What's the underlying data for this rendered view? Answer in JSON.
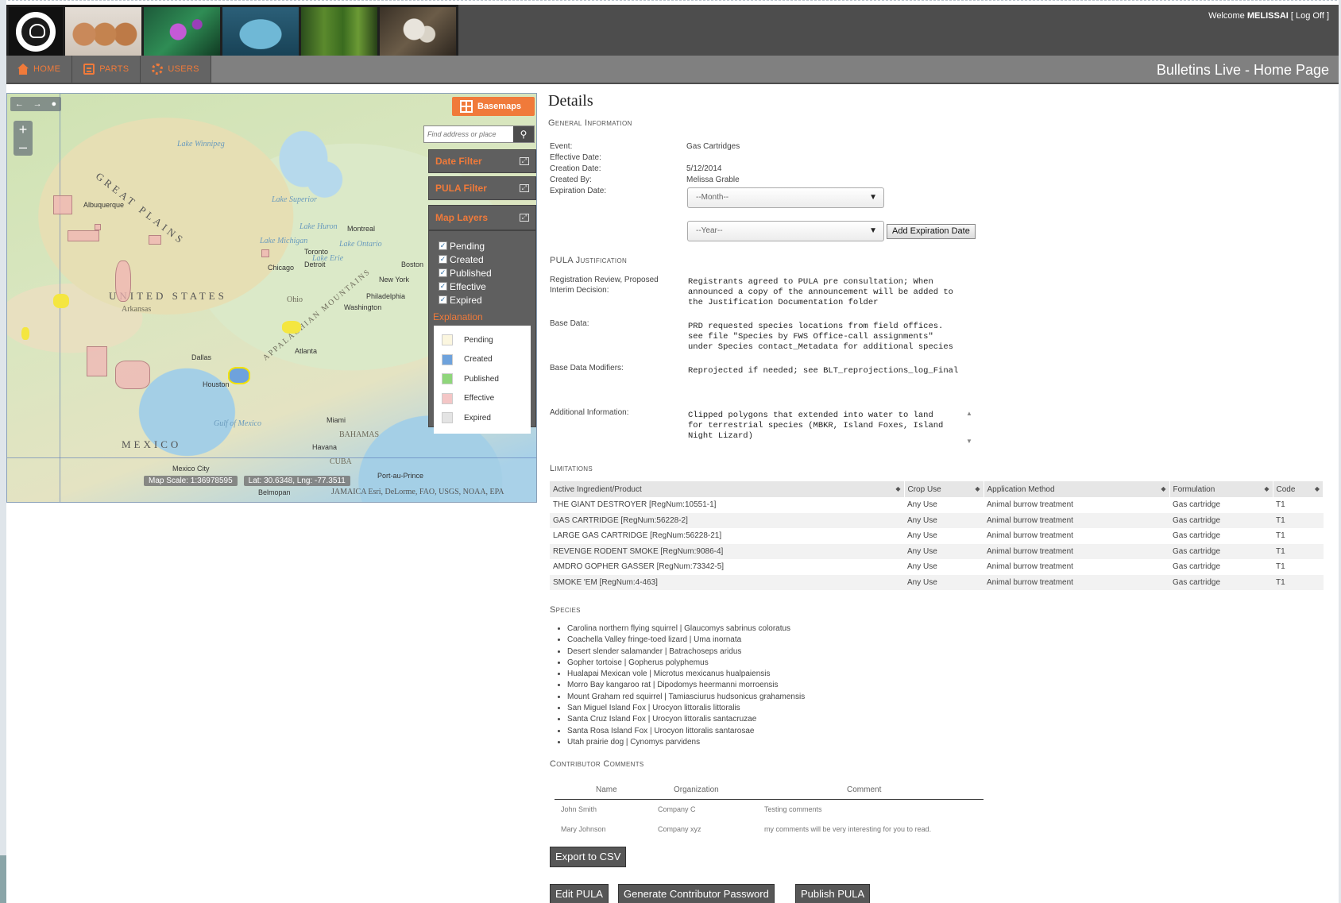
{
  "header": {
    "welcome_prefix": "Welcome",
    "username": "MELISSAI",
    "logoff": "[ Log Off ]",
    "page_title": "Bulletins Live - Home Page",
    "photos": [
      "epa-seal",
      "clay-jars",
      "purple-flower",
      "fish",
      "plants",
      "bird-chicks"
    ]
  },
  "nav": {
    "items": [
      {
        "label": "HOME",
        "icon": "home-icon"
      },
      {
        "label": "PARTS",
        "icon": "clipboard-icon"
      },
      {
        "label": "USERS",
        "icon": "gear-icon"
      }
    ]
  },
  "map": {
    "basemaps_label": "Basemaps",
    "search_placeholder": "Find address or place",
    "date_filter": "Date Filter",
    "pula_filter": "PULA Filter",
    "map_layers": "Map Layers",
    "layers": [
      "Pending",
      "Created",
      "Published",
      "Effective",
      "Expired"
    ],
    "explanation_title": "Explanation",
    "legend": [
      {
        "label": "Pending",
        "color": "#fbf6df"
      },
      {
        "label": "Created",
        "color": "#6ea2dc"
      },
      {
        "label": "Published",
        "color": "#8fd67b"
      },
      {
        "label": "Effective",
        "color": "#f4c6c6"
      },
      {
        "label": "Expired",
        "color": "#e4e4e4"
      }
    ],
    "scale": "Map Scale: 1:36978595",
    "coords": "Lat: 30.6348, Lng: -77.3511",
    "attribution": "Esri, DeLorme, FAO, USGS, NOAA, EPA",
    "labels": {
      "great_plains": "GREAT PLAINS",
      "united_states": "UNITED STATES",
      "mexico": "MEXICO",
      "appalachian": "APPALACHIAN MOUNTAINS",
      "gulf": "Gulf of Mexico",
      "bahamas": "BAHAMAS",
      "cuba": "CUBA",
      "jamaica": "JAMAICA",
      "lake_superior": "Lake Superior",
      "lake_huron": "Lake Huron",
      "lake_ontario": "Lake Ontario",
      "lake_michigan": "Lake Michigan",
      "lake_erie": "Lake Erie",
      "lake_winnipeg": "Lake Winnipeg",
      "montreal": "Montreal",
      "toronto": "Toronto",
      "boston": "Boston",
      "new_york": "New York",
      "philadelphia": "Philadelphia",
      "washington": "Washington",
      "chicago": "Chicago",
      "detroit": "Detroit",
      "atlanta": "Atlanta",
      "dallas": "Dallas",
      "houston": "Houston",
      "miami": "Miami",
      "havana": "Havana",
      "mexico_city": "Mexico City",
      "belmopan": "Belmopan",
      "port_au_prince": "Port-au-Prince",
      "albuquerque": "Albuquerque",
      "arkansas": "Arkansas",
      "ohio": "Ohio"
    }
  },
  "details": {
    "title": "Details",
    "general_info": "General Information",
    "event_label": "Event:",
    "event_value": "Gas Cartridges",
    "effective_label": "Effective Date:",
    "creation_label": "Creation Date:",
    "creation_value": "5/12/2014",
    "created_by_label": "Created By:",
    "created_by_value": "Melissa Grable",
    "expiration_label": "Expiration Date:",
    "month_select": "--Month--",
    "year_select": "--Year--",
    "add_expiration": "Add Expiration Date",
    "pula_justification": "PULA Justification",
    "reg_review_label": "Registration Review, Proposed Interim Decision:",
    "reg_review_text": "Registrants agreed to PULA pre consultation; When\nannounced a copy of the announcement will be added to\nthe Justification Documentation folder",
    "base_data_label": "Base Data:",
    "base_data_text": "PRD requested species locations from field offices.\nsee file \"Species by FWS Office-call assignments\"\nunder Species contact_Metadata for additional species",
    "base_modifiers_label": "Base Data Modifiers:",
    "base_modifiers_text": "Reprojected if needed; see BLT_reprojections_log_Final",
    "additional_label": "Additional Information:",
    "additional_text": "Clipped polygons that extended into water to land\nfor terrestrial species (MBKR, Island Foxes, Island\nNight Lizard)",
    "limitations": "Limitations",
    "columns": [
      "Active Ingredient/Product",
      "Crop Use",
      "Application Method",
      "Formulation",
      "Code"
    ],
    "rows": [
      [
        "THE GIANT DESTROYER [RegNum:10551-1]",
        "Any Use",
        "Animal burrow treatment",
        "Gas cartridge",
        "T1"
      ],
      [
        "GAS CARTRIDGE [RegNum:56228-2]",
        "Any Use",
        "Animal burrow treatment",
        "Gas cartridge",
        "T1"
      ],
      [
        "LARGE GAS CARTRIDGE [RegNum:56228-21]",
        "Any Use",
        "Animal burrow treatment",
        "Gas cartridge",
        "T1"
      ],
      [
        "REVENGE RODENT SMOKE [RegNum:9086-4]",
        "Any Use",
        "Animal burrow treatment",
        "Gas cartridge",
        "T1"
      ],
      [
        "AMDRO GOPHER GASSER [RegNum:73342-5]",
        "Any Use",
        "Animal burrow treatment",
        "Gas cartridge",
        "T1"
      ],
      [
        "SMOKE 'EM [RegNum:4-463]",
        "Any Use",
        "Animal burrow treatment",
        "Gas cartridge",
        "T1"
      ]
    ],
    "species_title": "Species",
    "species": [
      "Carolina northern flying squirrel | Glaucomys sabrinus coloratus",
      "Coachella Valley fringe-toed lizard | Uma inornata",
      "Desert slender salamander | Batrachoseps aridus",
      "Gopher tortoise | Gopherus polyphemus",
      "Hualapai Mexican vole | Microtus mexicanus hualpaiensis",
      "Morro Bay kangaroo rat | Dipodomys heermanni morroensis",
      "Mount Graham red squirrel | Tamiasciurus hudsonicus grahamensis",
      "San Miguel Island Fox | Urocyon littoralis littoralis",
      "Santa Cruz Island Fox | Urocyon littoralis santacruzae",
      "Santa Rosa Island Fox | Urocyon littoralis santarosae",
      "Utah prairie dog | Cynomys parvidens"
    ],
    "comments_title": "Contributor Comments",
    "comment_columns": [
      "Name",
      "Organization",
      "Comment"
    ],
    "comments": [
      [
        "John Smith",
        "Company C",
        "Testing comments"
      ],
      [
        "Mary Johnson",
        "Company xyz",
        "my comments will be very interesting for you to read."
      ]
    ],
    "export_csv": "Export to CSV",
    "edit_pula": "Edit PULA",
    "generate_password": "Generate Contributor Password",
    "publish_pula": "Publish PULA"
  }
}
